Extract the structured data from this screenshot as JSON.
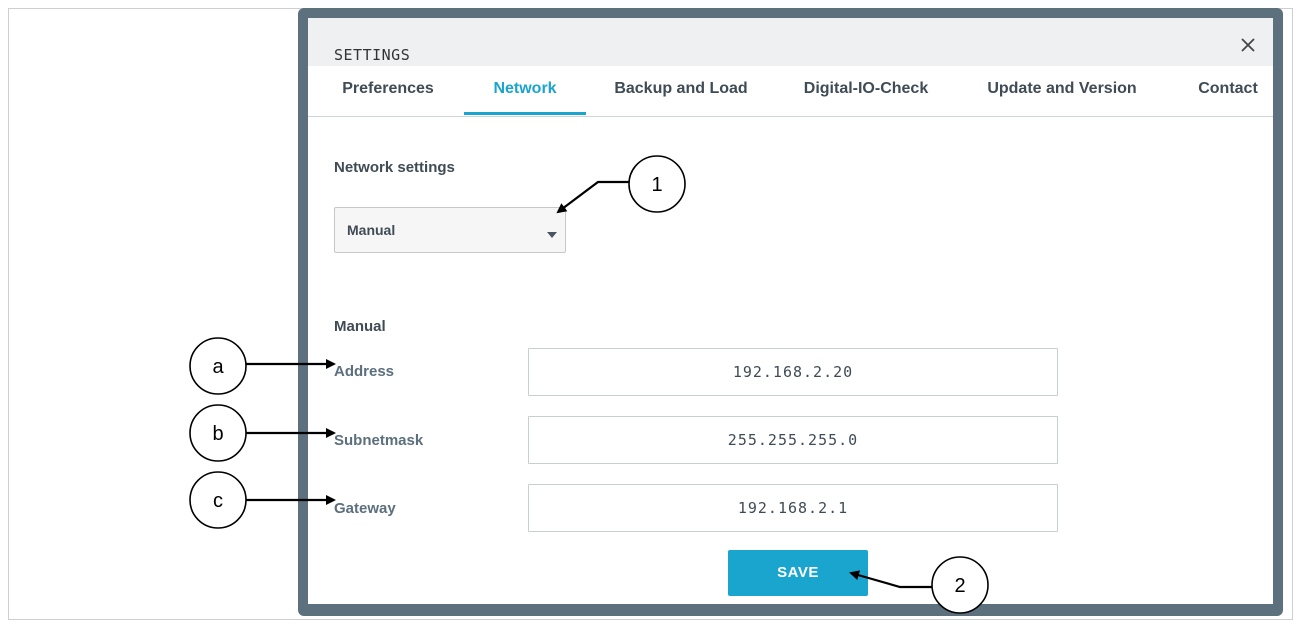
{
  "dialog": {
    "title": "SETTINGS",
    "close_icon": "close-icon"
  },
  "tabs": [
    {
      "label": "Preferences",
      "active": false
    },
    {
      "label": "Network",
      "active": true
    },
    {
      "label": "Backup and Load",
      "active": false
    },
    {
      "label": "Digital-IO-Check",
      "active": false
    },
    {
      "label": "Update and Version",
      "active": false
    },
    {
      "label": "Contact",
      "active": false
    }
  ],
  "network": {
    "section_title": "Network settings",
    "mode_select": {
      "value": "Manual",
      "icon": "caret-down-icon"
    },
    "manual_title": "Manual",
    "fields": [
      {
        "label": "Address",
        "value": "192.168.2.20"
      },
      {
        "label": "Subnetmask",
        "value": "255.255.255.0"
      },
      {
        "label": "Gateway",
        "value": "192.168.2.1"
      }
    ],
    "save_label": "SAVE"
  },
  "callouts": {
    "one": "1",
    "two": "2",
    "a": "a",
    "b": "b",
    "c": "c"
  },
  "colors": {
    "accent": "#1aa5cf",
    "frame": "#5c707d",
    "text": "#3f4b55"
  }
}
